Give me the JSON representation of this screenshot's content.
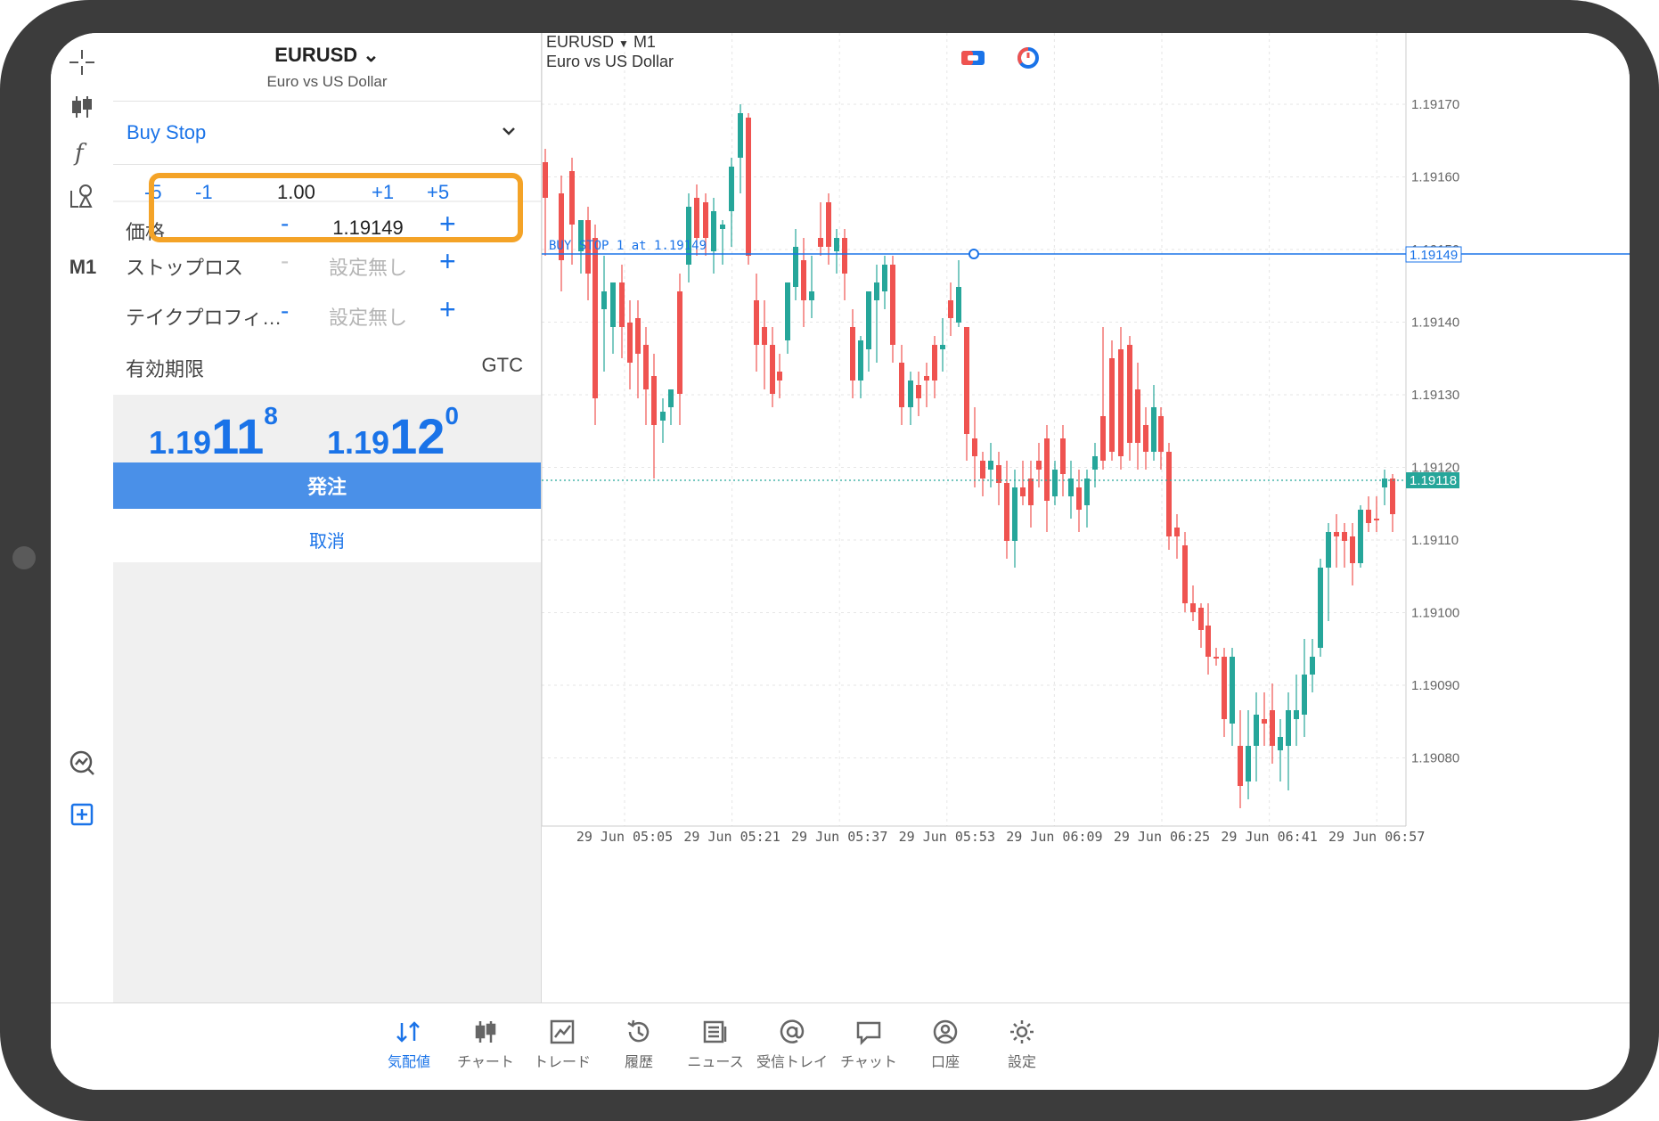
{
  "toolbar": {
    "timeframe": "M1",
    "icons": [
      "crosshair-icon",
      "candles-icon",
      "indicator-icon",
      "objects-icon",
      "timeframe",
      "trade-analytics-icon",
      "new-order-icon"
    ]
  },
  "order_panel": {
    "symbol": "EURUSD",
    "symbol_desc": "Euro vs US Dollar",
    "order_type": "Buy Stop",
    "volume": {
      "minus5": "-5",
      "minus1": "-1",
      "value": "1.00",
      "plus1": "+1",
      "plus5": "+5"
    },
    "price": {
      "label": "価格",
      "minus": "-",
      "value": "1.19149",
      "plus": "+"
    },
    "stop_loss": {
      "label": "ストップロス",
      "minus": "-",
      "placeholder": "設定無し",
      "plus": "+"
    },
    "take_profit": {
      "label": "テイクプロフィ…",
      "minus": "-",
      "placeholder": "設定無し",
      "plus": "+"
    },
    "expiration": {
      "label": "有効期限",
      "value": "GTC"
    },
    "bid": {
      "main": "1.19",
      "big": "11",
      "small": "8"
    },
    "ask": {
      "main": "1.19",
      "big": "12",
      "small": "0"
    },
    "place_label": "発注",
    "cancel_label": "取消"
  },
  "chart": {
    "symbol": "EURUSD",
    "timeframe": "M1",
    "desc": "Euro vs US Dollar",
    "order_line_label": "BUY STOP 1 at 1.19149",
    "colors": {
      "up": "#26a69a",
      "down": "#ef5350",
      "order_line": "#1a73e8",
      "bid_line": "#26a69a"
    },
    "y_ticks": [
      "1.19170",
      "1.19160",
      "1.19150",
      "1.19140",
      "1.19130",
      "1.19120",
      "1.19110",
      "1.19100",
      "1.19090",
      "1.19080"
    ],
    "x_ticks": [
      "29 Jun 05:05",
      "29 Jun 05:21",
      "29 Jun 05:37",
      "29 Jun 05:53",
      "29 Jun 06:09",
      "29 Jun 06:25",
      "29 Jun 06:41",
      "29 Jun 06:57"
    ],
    "order_price_label": "1.19149",
    "bid_price_label": "1.19118"
  },
  "bottom_nav": [
    {
      "label": "気配値",
      "icon": "quotes-icon",
      "active": true
    },
    {
      "label": "チャート",
      "icon": "chart-icon",
      "active": false
    },
    {
      "label": "トレード",
      "icon": "trade-icon",
      "active": false
    },
    {
      "label": "履歴",
      "icon": "history-icon",
      "active": false
    },
    {
      "label": "ニュース",
      "icon": "news-icon",
      "active": false
    },
    {
      "label": "受信トレイ",
      "icon": "mail-icon",
      "active": false
    },
    {
      "label": "チャット",
      "icon": "chat-icon",
      "active": false
    },
    {
      "label": "口座",
      "icon": "account-icon",
      "active": false
    },
    {
      "label": "設定",
      "icon": "settings-icon",
      "active": false
    }
  ]
}
